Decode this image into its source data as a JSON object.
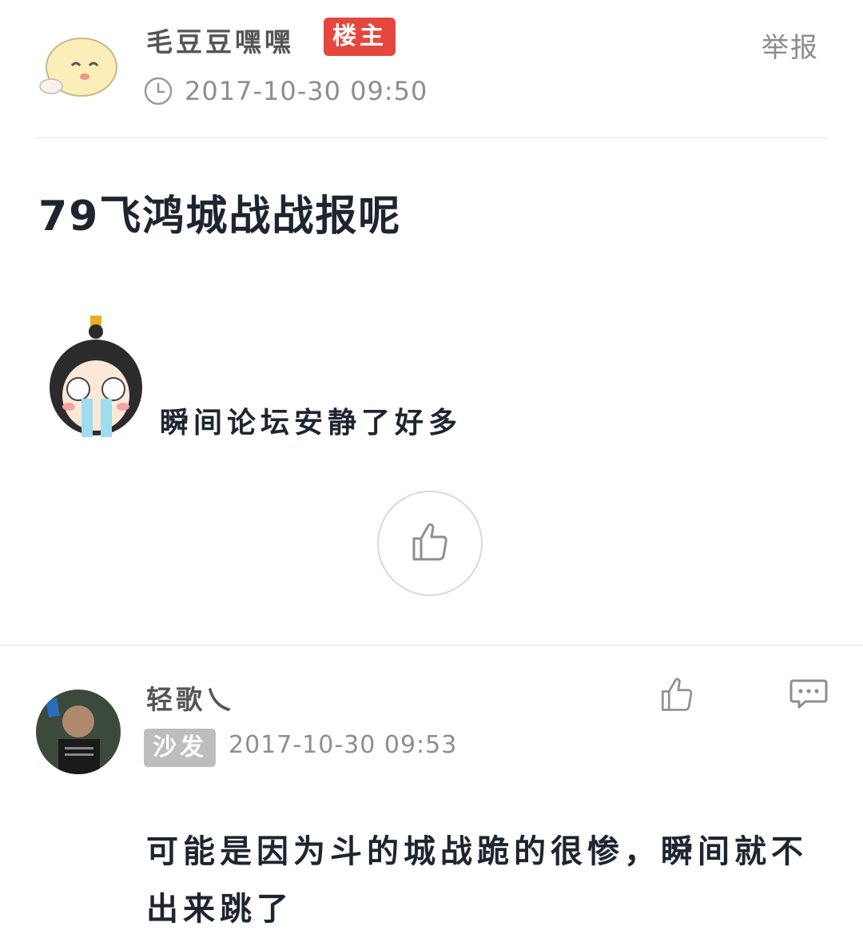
{
  "op": {
    "username": "毛豆豆嘿嘿",
    "badge": "楼主",
    "report_label": "举报",
    "timestamp": "2017-10-30 09:50",
    "title": "79飞鸿城战战报呢",
    "body": "瞬间论坛安静了好多"
  },
  "reply": {
    "username": "轻歌乀",
    "floor_badge": "沙发",
    "timestamp": "2017-10-30 09:53",
    "body": "可能是因为斗的城战跪的很惨，瞬间就不出来跳了"
  },
  "icons": {
    "clock": "clock-icon",
    "like": "thumbs-up-icon",
    "comment": "comment-icon"
  },
  "colors": {
    "op_badge": "#e5473d",
    "floor_badge": "#bdbdbd",
    "meta_text": "#8e8e8e"
  }
}
